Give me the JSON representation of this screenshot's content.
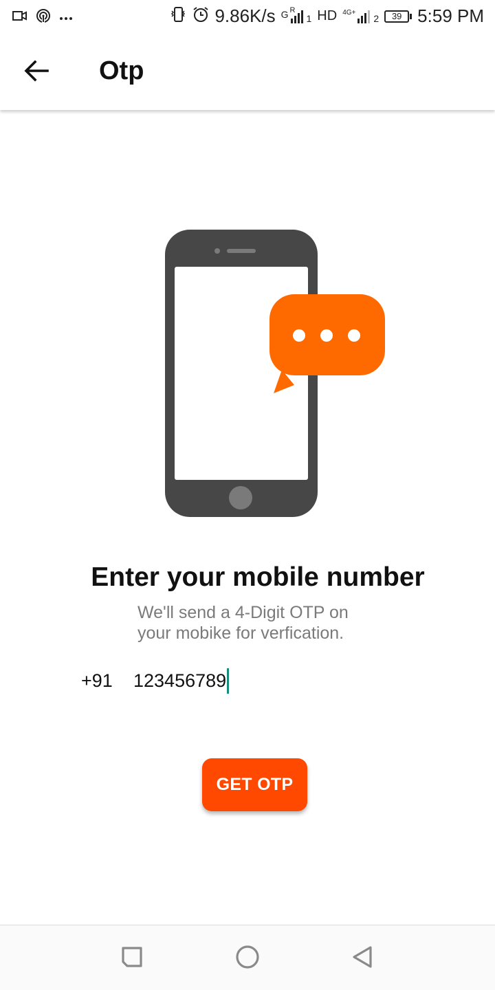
{
  "status_bar": {
    "speed": "9.86K/s",
    "network_1_label": "G",
    "network_1_roaming": "R",
    "sim_1": "1",
    "hd": "HD",
    "network_2_label": "4G+",
    "sim_2": "2",
    "battery": "39",
    "time": "5:59 PM",
    "icons": [
      "video-icon",
      "hotspot-icon",
      "more-dots-icon",
      "vibrate-icon",
      "alarm-icon",
      "signal-icon",
      "battery-icon"
    ]
  },
  "app_bar": {
    "title": "Otp",
    "back_icon": "arrow-left-icon"
  },
  "illustration": {
    "phone_color": "#474747",
    "bubble_color": "#ff6a00"
  },
  "content": {
    "heading": "Enter your mobile number",
    "sub_line_1": "We'll send a 4-Digit OTP on",
    "sub_line_2": "your mobike for verfication.",
    "country_code": "+91",
    "phone_value": "123456789",
    "button_label": "GET OTP",
    "accent": "#ff4800"
  },
  "nav_bar": {
    "icons": [
      "recents-square-icon",
      "home-circle-icon",
      "back-triangle-icon"
    ]
  }
}
